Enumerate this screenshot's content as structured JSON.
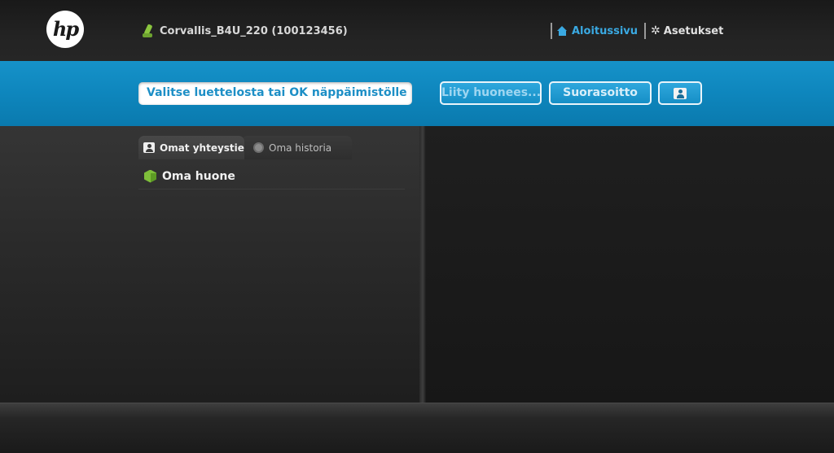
{
  "header": {
    "logo_text": "hp",
    "device_name": "Corvallis_B4U_220 (100123456)",
    "nav": {
      "home_label": "Aloitussivu",
      "settings_label": "Asetukset"
    }
  },
  "toolbar": {
    "search_value": "Valitse luettelosta tai OK näppäimistölle",
    "join_room_label": "Liity huonees...",
    "direct_call_label": "Suorasoitto",
    "contacts_button_icon": "contact-book-icon"
  },
  "tabs": [
    {
      "label": "Omat yhteystiedot",
      "active": true,
      "icon": "contact-book-icon"
    },
    {
      "label": "Oma historia",
      "active": false,
      "icon": "clock-icon"
    }
  ],
  "list": {
    "items": [
      {
        "label": "Oma huone",
        "icon": "room-cube-icon"
      }
    ]
  },
  "colors": {
    "accent_blue": "#1692c9",
    "home_link": "#3aa9e2",
    "room_green": "#7fbf3a"
  }
}
